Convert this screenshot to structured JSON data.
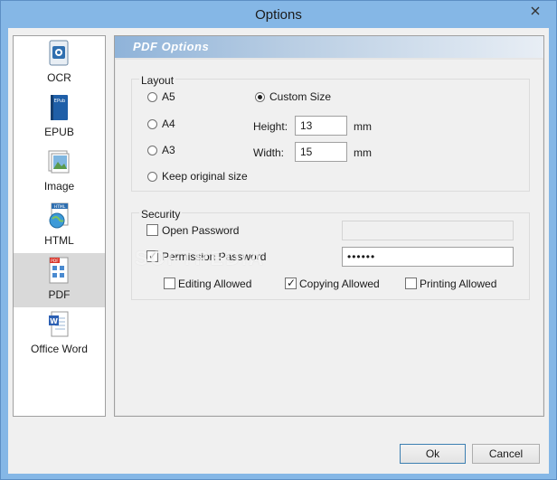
{
  "window": {
    "title": "Options"
  },
  "sidebar": {
    "items": [
      {
        "label": "OCR",
        "icon": "ocr-icon"
      },
      {
        "label": "EPUB",
        "icon": "epub-book-icon",
        "icon_text": "EPub"
      },
      {
        "label": "Image",
        "icon": "image-icon"
      },
      {
        "label": "HTML",
        "icon": "html-globe-icon",
        "icon_text": "HTML"
      },
      {
        "label": "PDF",
        "icon": "pdf-document-icon",
        "icon_text": "PDF",
        "selected": true
      },
      {
        "label": "Office Word",
        "icon": "word-document-icon",
        "icon_text": "W"
      }
    ]
  },
  "panel": {
    "header": "PDF Options",
    "layout": {
      "label": "Layout",
      "a5": "A5",
      "a4": "A4",
      "a3": "A3",
      "keep": "Keep original size",
      "custom": "Custom Size",
      "selected": "Custom Size",
      "height_label": "Height:",
      "height_value": "13",
      "width_label": "Width:",
      "width_value": "15",
      "unit": "mm"
    },
    "security": {
      "label": "Security",
      "open_password": "Open Password",
      "open_password_checked": false,
      "open_password_value": "",
      "permission_password": "Permission Password",
      "permission_password_checked": true,
      "permission_password_value": "••••••",
      "editing": "Editing Allowed",
      "editing_checked": false,
      "copying": "Copying Allowed",
      "copying_checked": true,
      "printing": "Printing Allowed",
      "printing_checked": false
    }
  },
  "buttons": {
    "ok": "Ok",
    "cancel": "Cancel"
  },
  "watermark": "SOFTPEDIA",
  "colors": {
    "titlebar": "#85b7e6",
    "selected_item": "#d9d9d9",
    "header_gradient_start": "#8fb3d9"
  }
}
